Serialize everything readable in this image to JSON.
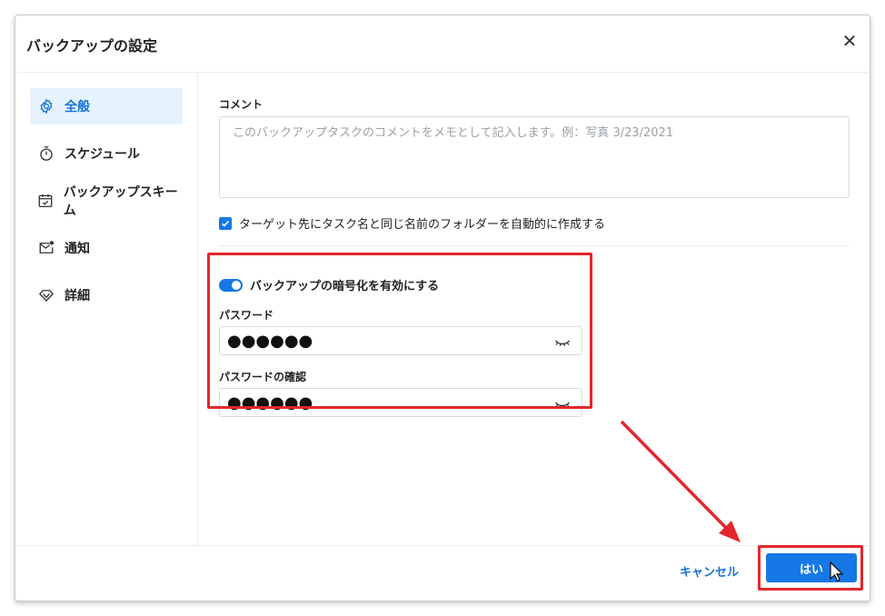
{
  "dialog": {
    "title": "バックアップの設定",
    "close_icon": "close-icon"
  },
  "sidebar": {
    "items": [
      {
        "label": "全般",
        "icon": "gear-icon",
        "active": true
      },
      {
        "label": "スケジュール",
        "icon": "timer-icon",
        "active": false
      },
      {
        "label": "バックアップスキーム",
        "icon": "calendar-check-icon",
        "active": false
      },
      {
        "label": "通知",
        "icon": "mail-notification-icon",
        "active": false
      },
      {
        "label": "詳細",
        "icon": "diamond-icon",
        "active": false
      }
    ]
  },
  "general": {
    "comment_label": "コメント",
    "comment_placeholder": "このバックアップタスクのコメントをメモとして記入します。例：写真 3/23/2021",
    "folder_checkbox_label": "ターゲット先にタスク名と同じ名前のフォルダーを自動的に作成する",
    "folder_checkbox_checked": true
  },
  "encryption": {
    "toggle_label": "バックアップの暗号化を有効にする",
    "enabled": true,
    "password_label": "パスワード",
    "password_value": "●●●●●●",
    "confirm_label": "パスワードの確認",
    "confirm_value": "●●●●●●"
  },
  "footer": {
    "cancel_label": "キャンセル",
    "ok_label": "はい"
  },
  "colors": {
    "accent": "#1677e6",
    "active_bg": "#e6f2fd",
    "annotation_red": "#e3262c"
  }
}
